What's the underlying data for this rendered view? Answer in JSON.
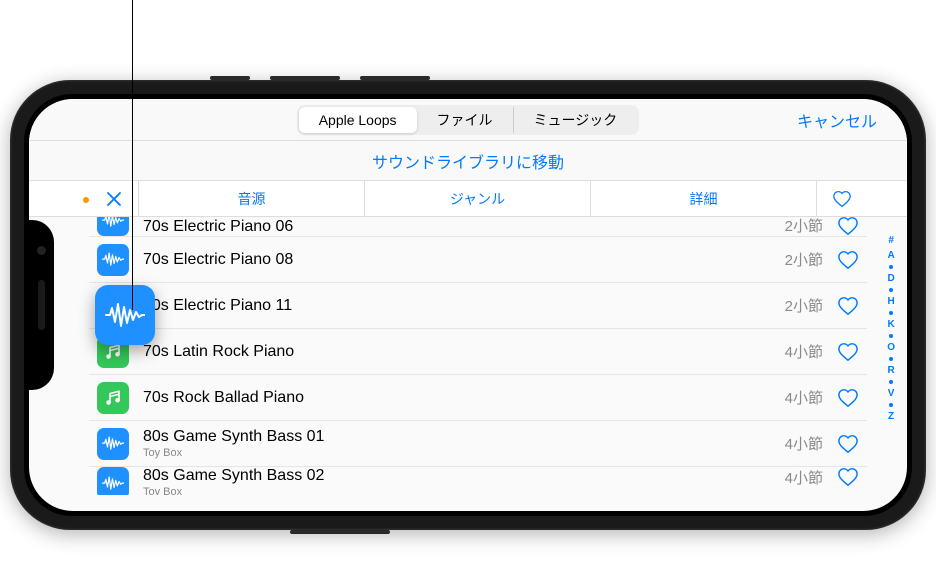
{
  "header": {
    "segments": [
      "Apple Loops",
      "ファイル",
      "ミュージック"
    ],
    "active_index": 0,
    "cancel": "キャンセル"
  },
  "subheader": {
    "label": "サウンドライブラリに移動"
  },
  "filters": {
    "tabs": [
      "音源",
      "ジャンル",
      "詳細"
    ]
  },
  "loops": [
    {
      "icon": "blue",
      "title": "70s Electric Piano 06",
      "length": "2小節",
      "cut": "top"
    },
    {
      "icon": "blue",
      "title": "70s Electric Piano 08",
      "length": "2小節"
    },
    {
      "icon": "blue",
      "title": "70s Electric Piano 11",
      "length": "2小節",
      "dragging": true
    },
    {
      "icon": "green",
      "title": "70s Latin Rock Piano",
      "length": "4小節"
    },
    {
      "icon": "green",
      "title": "70s Rock Ballad Piano",
      "length": "4小節"
    },
    {
      "icon": "blue",
      "title": "80s Game Synth Bass 01",
      "subtitle": "Toy Box",
      "length": "4小節"
    },
    {
      "icon": "blue",
      "title": "80s Game Synth Bass 02",
      "subtitle": "Toy Box",
      "length": "4小節",
      "cut": "bottom"
    }
  ],
  "index": [
    "#",
    "A",
    "•",
    "D",
    "•",
    "H",
    "•",
    "K",
    "•",
    "O",
    "•",
    "R",
    "•",
    "V",
    "•",
    "Z"
  ]
}
